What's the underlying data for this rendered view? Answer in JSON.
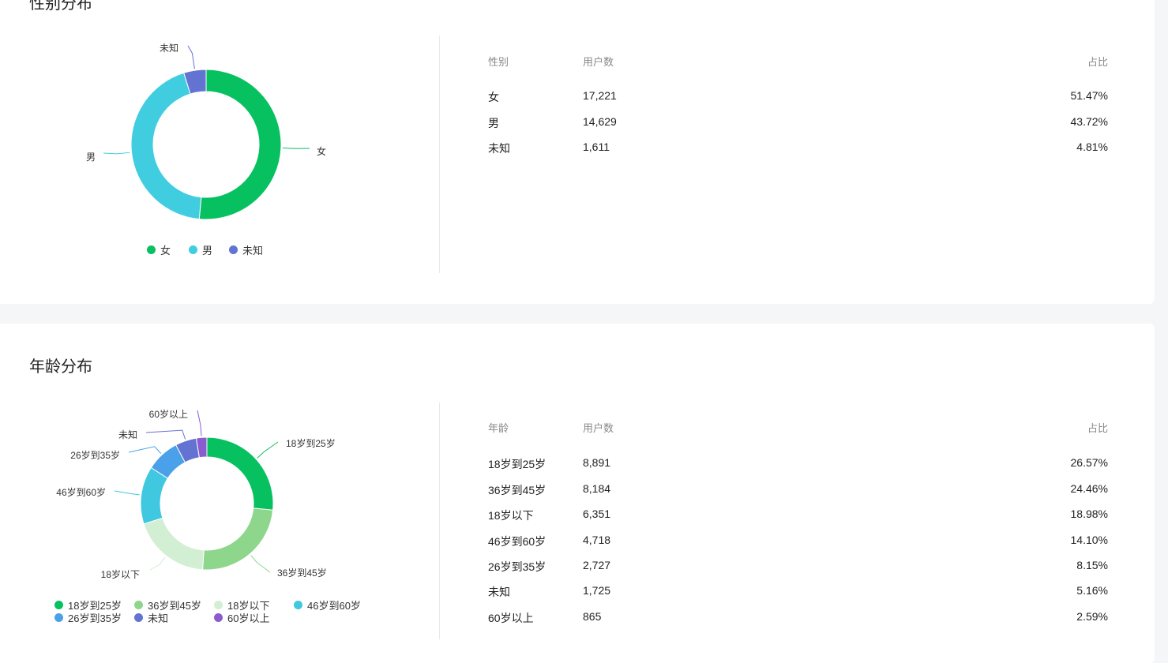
{
  "gender": {
    "title": "性别分布",
    "headers": {
      "col1": "性别",
      "col2": "用户数",
      "col3": "占比"
    },
    "rows": [
      {
        "label": "女",
        "count": "17,221",
        "pct": "51.47%",
        "value": 17221,
        "color": "#07c160"
      },
      {
        "label": "男",
        "count": "14,629",
        "pct": "43.72%",
        "value": 14629,
        "color": "#40cde0"
      },
      {
        "label": "未知",
        "count": "1,611",
        "pct": "4.81%",
        "value": 1611,
        "color": "#6373d2"
      }
    ],
    "chart_data": {
      "type": "pie",
      "categories": [
        "女",
        "男",
        "未知"
      ],
      "values": [
        17221,
        14629,
        1611
      ],
      "legend": "bottom"
    }
  },
  "age": {
    "title": "年龄分布",
    "headers": {
      "col1": "年龄",
      "col2": "用户数",
      "col3": "占比"
    },
    "rows": [
      {
        "label": "18岁到25岁",
        "count": "8,891",
        "pct": "26.57%",
        "value": 8891,
        "color": "#07c160"
      },
      {
        "label": "36岁到45岁",
        "count": "8,184",
        "pct": "24.46%",
        "value": 8184,
        "color": "#8ed68c"
      },
      {
        "label": "18岁以下",
        "count": "6,351",
        "pct": "18.98%",
        "value": 6351,
        "color": "#d3efd3"
      },
      {
        "label": "46岁到60岁",
        "count": "4,718",
        "pct": "14.10%",
        "value": 4718,
        "color": "#40c8e0"
      },
      {
        "label": "26岁到35岁",
        "count": "2,727",
        "pct": "8.15%",
        "value": 2727,
        "color": "#4aa1ea"
      },
      {
        "label": "未知",
        "count": "1,725",
        "pct": "5.16%",
        "value": 1725,
        "color": "#6373d2"
      },
      {
        "label": "60岁以上",
        "count": "865",
        "pct": "2.59%",
        "value": 865,
        "color": "#8a5ccf"
      }
    ],
    "chart_data": {
      "type": "pie",
      "categories": [
        "18岁到25岁",
        "36岁到45岁",
        "18岁以下",
        "46岁到60岁",
        "26岁到35岁",
        "未知",
        "60岁以上"
      ],
      "values": [
        8891,
        8184,
        6351,
        4718,
        2727,
        1725,
        865
      ],
      "legend": "bottom"
    }
  }
}
